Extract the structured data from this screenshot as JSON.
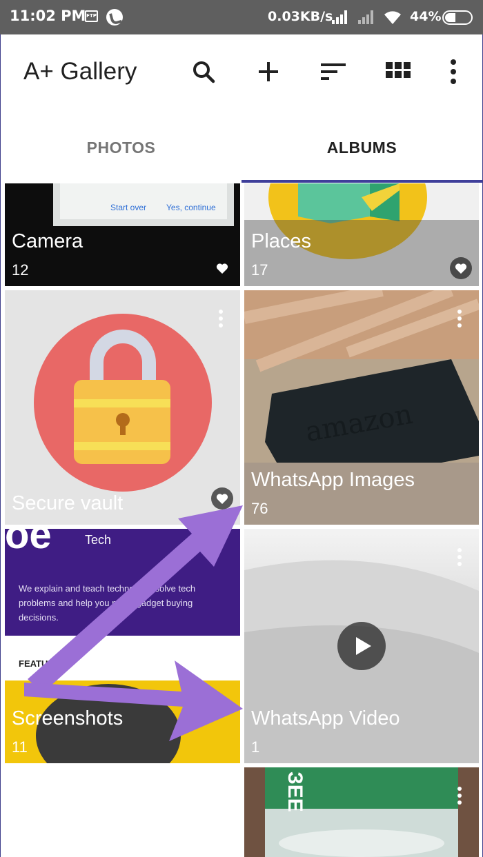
{
  "status_bar": {
    "time": "11:02 PM",
    "ftp_label": "FTP",
    "network_speed": "0.03KB/s",
    "battery": "44%"
  },
  "app_bar": {
    "title": "A+ Gallery",
    "actions": [
      "search-icon",
      "add-icon",
      "sort-icon",
      "grid-view-icon",
      "more-vert-icon"
    ]
  },
  "tabs": [
    {
      "label": "PHOTOS",
      "selected": false
    },
    {
      "label": "ALBUMS",
      "selected": true
    }
  ],
  "albums": [
    {
      "name": "Camera",
      "count": "12",
      "favorite": true
    },
    {
      "name": "Places",
      "count": "17",
      "favorite": true
    },
    {
      "name": "Secure vault",
      "count": "",
      "favorite": true
    },
    {
      "name": "WhatsApp Images",
      "count": "76",
      "favorite": false
    },
    {
      "name": "Screenshots",
      "count": "11",
      "favorite": false
    },
    {
      "name": "WhatsApp Video",
      "count": "1",
      "favorite": false
    },
    {
      "name": "",
      "count": "",
      "favorite": false
    }
  ],
  "thumbnail_text": {
    "camera_dialog_buttons": [
      "Start over",
      "Yes, continue"
    ],
    "screenshot_heading": "Tech",
    "screenshot_body": "We explain and teach technology, solve tech problems and help you make gadget buying decisions.",
    "screenshot_featured": "FEATURED",
    "amazon_logo": "amazon",
    "bottle_label": "ЗЕЕ"
  },
  "colors": {
    "status_bar": "#5f5f5f",
    "accent_indicator": "#3f3f9a",
    "annotation_arrow": "#9b6fd6"
  }
}
